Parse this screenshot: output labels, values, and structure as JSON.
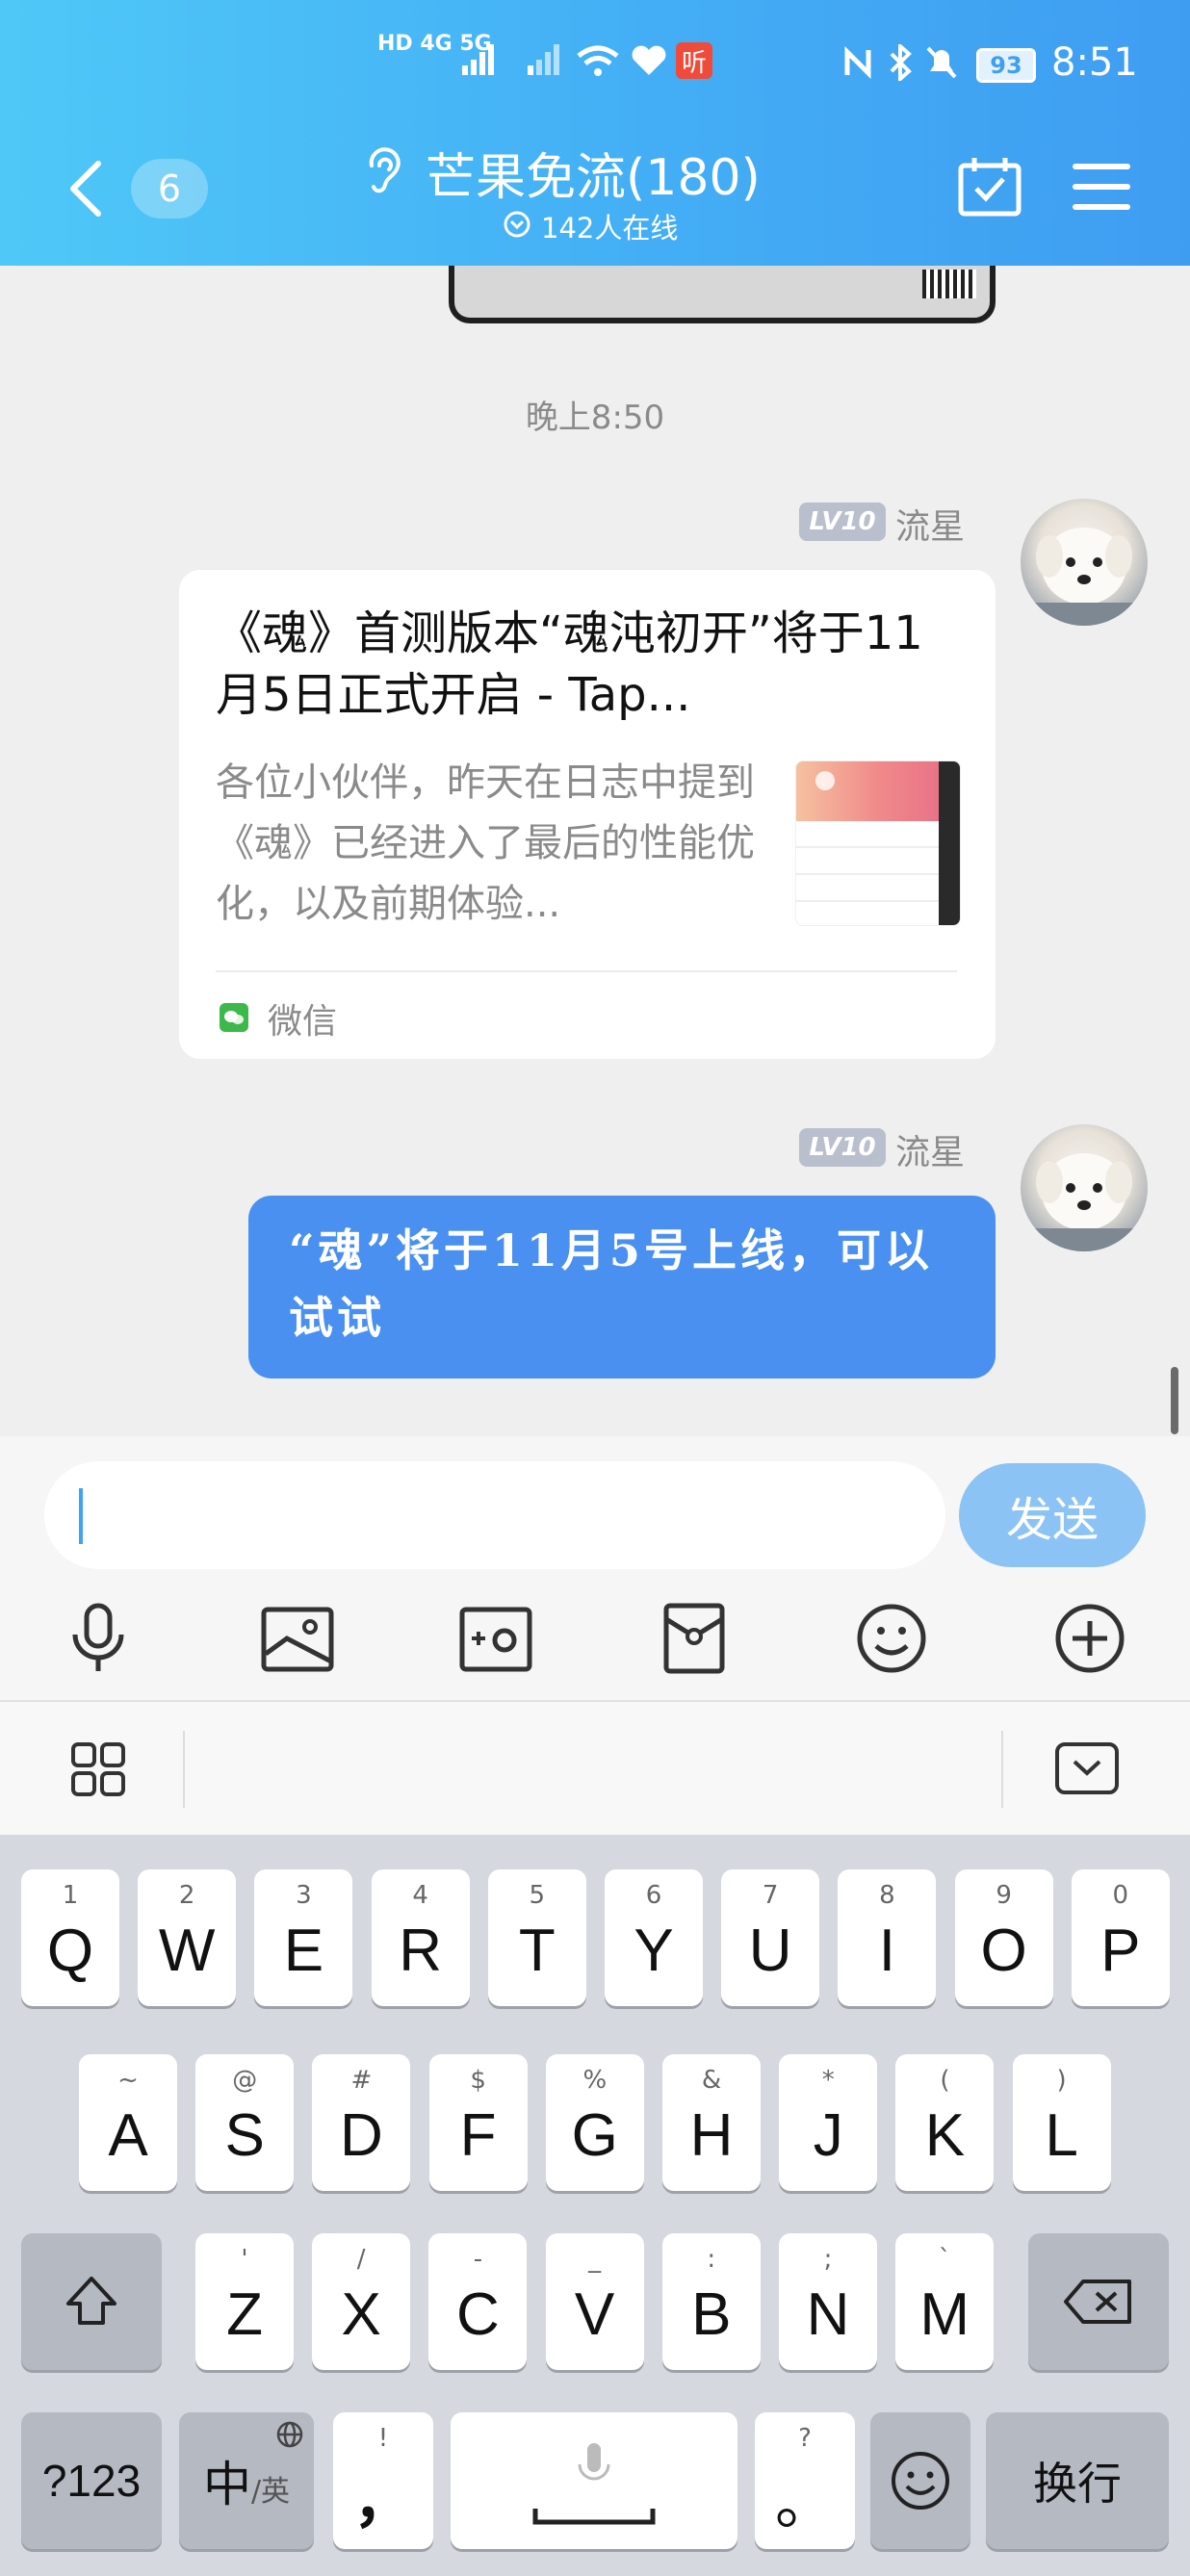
{
  "status_bar": {
    "time": "8:51",
    "battery": "93",
    "network_left": "HD 4G 5G",
    "app_badge": "听"
  },
  "header": {
    "back_count": "6",
    "title": "芒果免流(180)",
    "online": "142人在线"
  },
  "chat": {
    "timestamp": "晚上8:50",
    "messages": [
      {
        "level": "LV10",
        "sender": "流星",
        "type": "share_card",
        "title": "《魂》首测版本“魂沌初开”将于11月5日正式开启 - Tap...",
        "description": "各位小伙伴，昨天在日志中提到《魂》已经进入了最后的性能优化，以及前期体验...",
        "source": "微信"
      },
      {
        "level": "LV10",
        "sender": "流星",
        "type": "text",
        "text": "“魂”将于11月5号上线，可以试试"
      }
    ]
  },
  "composer": {
    "send_label": "发送",
    "input_value": ""
  },
  "keyboard": {
    "row1": [
      {
        "main": "Q",
        "sub": "1"
      },
      {
        "main": "W",
        "sub": "2"
      },
      {
        "main": "E",
        "sub": "3"
      },
      {
        "main": "R",
        "sub": "4"
      },
      {
        "main": "T",
        "sub": "5"
      },
      {
        "main": "Y",
        "sub": "6"
      },
      {
        "main": "U",
        "sub": "7"
      },
      {
        "main": "I",
        "sub": "8"
      },
      {
        "main": "O",
        "sub": "9"
      },
      {
        "main": "P",
        "sub": "0"
      }
    ],
    "row2": [
      {
        "main": "A",
        "sub": "~"
      },
      {
        "main": "S",
        "sub": "@"
      },
      {
        "main": "D",
        "sub": "#"
      },
      {
        "main": "F",
        "sub": "$"
      },
      {
        "main": "G",
        "sub": "%"
      },
      {
        "main": "H",
        "sub": "&"
      },
      {
        "main": "J",
        "sub": "*"
      },
      {
        "main": "K",
        "sub": "("
      },
      {
        "main": "L",
        "sub": ")"
      }
    ],
    "row3": [
      {
        "main": "Z",
        "sub": "'"
      },
      {
        "main": "X",
        "sub": "/"
      },
      {
        "main": "C",
        "sub": "-"
      },
      {
        "main": "V",
        "sub": "_"
      },
      {
        "main": "B",
        "sub": ":"
      },
      {
        "main": "N",
        "sub": ";"
      },
      {
        "main": "M",
        "sub": "`"
      }
    ],
    "sym_label": "?123",
    "lang_label": "中",
    "lang_sub": "/英",
    "comma_label": "，",
    "comma_sub": "!",
    "period_label": "。",
    "period_sub": "?",
    "enter_label": "换行"
  },
  "colors": {
    "header_start": "#4fc8f7",
    "header_end": "#3f9df1",
    "bubble": "#4a90f0",
    "send_button": "#8cc3f5",
    "wechat_green": "#3cb94a"
  }
}
